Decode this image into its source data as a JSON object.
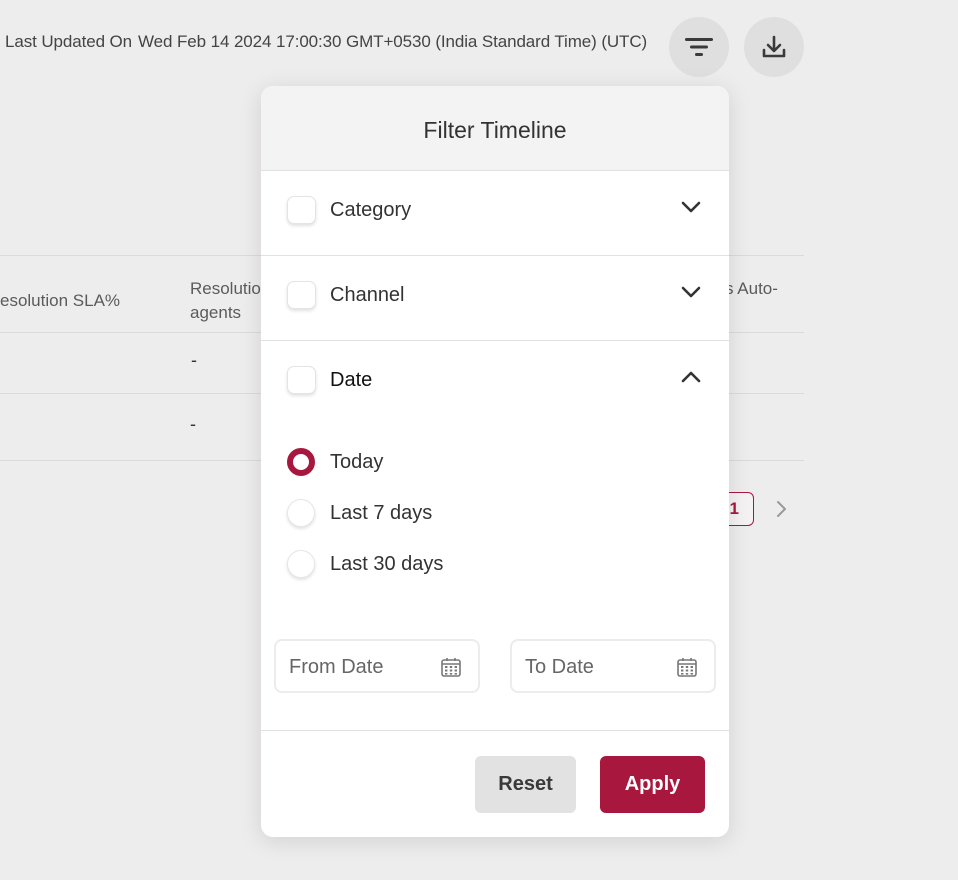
{
  "topbar": {
    "last_updated_label": "Last Updated On",
    "timestamp": "Wed Feb 14 2024 17:00:30 GMT+0530 (India Standard Time) (UTC)"
  },
  "icons": {
    "filter": "filter-icon",
    "download": "download-icon",
    "calendar": "calendar-icon",
    "chevron_down": "chevron-down-icon",
    "chevron_up": "chevron-up-icon",
    "chevron_right": "chevron-right-icon"
  },
  "table": {
    "headers": [
      "esolution SLA%",
      "Resolutio",
      "agents",
      "s Auto-"
    ],
    "rows": [
      [
        "-"
      ],
      [
        "-"
      ]
    ]
  },
  "pagination": {
    "current": "1"
  },
  "filter_popup": {
    "title": "Filter Timeline",
    "sections": [
      {
        "label": "Category",
        "expanded": false
      },
      {
        "label": "Channel",
        "expanded": false
      },
      {
        "label": "Date",
        "expanded": true
      }
    ],
    "date_options": [
      "Today",
      "Last 7 days",
      "Last 30 days"
    ],
    "selected_option": "Today",
    "from_date_placeholder": "From Date",
    "to_date_placeholder": "To Date",
    "reset_label": "Reset",
    "apply_label": "Apply"
  },
  "colors": {
    "accent": "#a8183e",
    "background": "#eeeded",
    "popup": "#ffffff"
  }
}
